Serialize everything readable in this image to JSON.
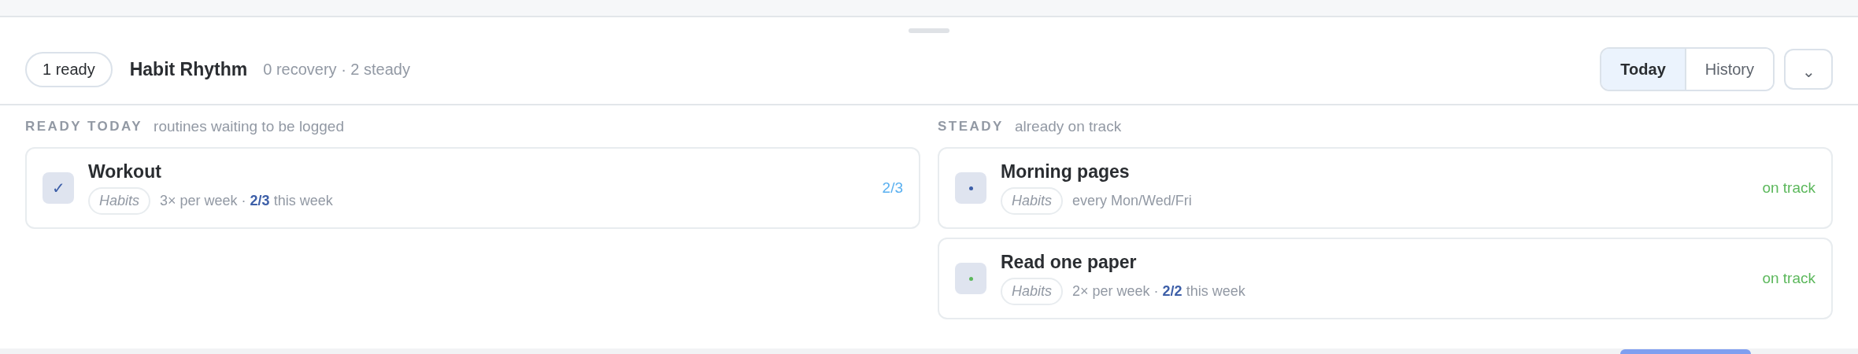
{
  "header": {
    "badge": "1 ready",
    "title": "Habit Rhythm",
    "summary": "0 recovery · 2 steady",
    "tabs": [
      {
        "label": "Today",
        "selected": true
      },
      {
        "label": "History",
        "selected": false
      }
    ],
    "menu_button": "⌄"
  },
  "sections": [
    {
      "label": "READY TODAY",
      "hint": "routines waiting to be logged",
      "items": [
        {
          "name": "Workout",
          "checked": true,
          "mark": "✓",
          "tag": "Habits",
          "meta": "3× per week · **2/3** this week",
          "status": {
            "text": "2/3",
            "color": "#5ab0f0"
          }
        }
      ]
    },
    {
      "label": "STEADY",
      "hint": "already on track",
      "items": [
        {
          "name": "Morning pages",
          "checked": false,
          "color": "#3d5fa8",
          "tag": "Habits",
          "meta": "every Mon/Wed/Fri",
          "status": {
            "text": "on track",
            "color": "#5cb85c"
          }
        },
        {
          "name": "Read one paper",
          "checked": false,
          "color": "#5cb85c",
          "tag": "Habits",
          "meta": "2× per week · **2/2** this week",
          "status": {
            "text": "on track",
            "color": "#5cb85c"
          }
        }
      ]
    }
  ]
}
